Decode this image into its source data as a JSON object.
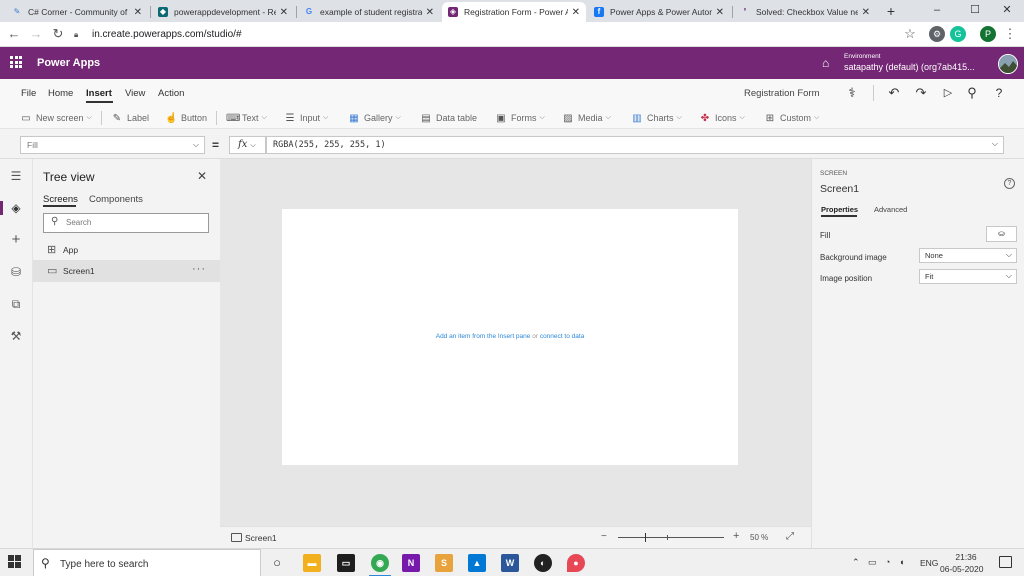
{
  "browser": {
    "tabs": [
      {
        "title": "C# Corner - Community of Software and Data Developers",
        "favicon": "csharp-icon",
        "color": "#3a7bd5"
      },
      {
        "title": "powerappdevelopment - Registration",
        "favicon": "dynamics-icon",
        "color": "#0b6a74"
      },
      {
        "title": "example of student registration form",
        "favicon": "google-icon",
        "color": "#4285f4"
      },
      {
        "title": "Registration Form - Power Apps",
        "favicon": "powerapps-icon",
        "color": "#742774"
      },
      {
        "title": "Power Apps & Power Automate",
        "favicon": "facebook-icon",
        "color": "#1877f2"
      },
      {
        "title": "Solved: Checkbox Value needed",
        "favicon": "powerapps-community-icon",
        "color": "#742774"
      }
    ],
    "new_tab_label": "+",
    "url": "in.create.powerapps.com/studio/#",
    "profile_initial": "P",
    "window_controls": {
      "minimize": "–",
      "maximize": "☐",
      "close": "✕"
    }
  },
  "powerapps": {
    "brand": "Power Apps",
    "environment_label": "Environment",
    "environment_name": "satapathy (default) (org7ab415...",
    "accent_color": "#742774"
  },
  "menu": {
    "items": [
      "File",
      "Home",
      "Insert",
      "View",
      "Action"
    ],
    "active": "Insert",
    "app_name": "Registration Form"
  },
  "toolbar": {
    "items": [
      {
        "label": "New screen",
        "icon": "new-screen-icon",
        "dropdown": true
      },
      {
        "label": "Label",
        "icon": "label-icon",
        "dropdown": false
      },
      {
        "label": "Button",
        "icon": "button-icon",
        "dropdown": false
      },
      {
        "label": "Text",
        "icon": "text-icon",
        "dropdown": true
      },
      {
        "label": "Input",
        "icon": "input-icon",
        "dropdown": true
      },
      {
        "label": "Gallery",
        "icon": "gallery-icon",
        "dropdown": true
      },
      {
        "label": "Data table",
        "icon": "data-table-icon",
        "dropdown": false
      },
      {
        "label": "Forms",
        "icon": "forms-icon",
        "dropdown": true
      },
      {
        "label": "Media",
        "icon": "media-icon",
        "dropdown": true
      },
      {
        "label": "Charts",
        "icon": "charts-icon",
        "dropdown": true
      },
      {
        "label": "Icons",
        "icon": "icons-icon",
        "dropdown": true
      },
      {
        "label": "Custom",
        "icon": "custom-icon",
        "dropdown": true
      }
    ]
  },
  "formula": {
    "property": "Fill",
    "equals": "=",
    "fx_label": "fx",
    "value": "RGBA(255, 255, 255, 1)"
  },
  "treeview": {
    "title": "Tree view",
    "tabs": [
      "Screens",
      "Components"
    ],
    "active_tab": "Screens",
    "search_placeholder": "Search",
    "items": [
      {
        "label": "App",
        "icon": "app-icon",
        "selected": false
      },
      {
        "label": "Screen1",
        "icon": "screen-icon",
        "selected": true,
        "more": "···"
      }
    ]
  },
  "canvas": {
    "message_link1": "Add an item from the Insert pane",
    "message_mid": " or ",
    "message_link2": "connect to data"
  },
  "statusbar": {
    "screen": "Screen1",
    "zoom_minus": "−",
    "zoom_plus": "+",
    "zoom_percent": 50,
    "zoom_label": "50 %"
  },
  "properties": {
    "kind": "SCREEN",
    "name": "Screen1",
    "tabs": [
      "Properties",
      "Advanced"
    ],
    "active_tab": "Properties",
    "rows": [
      {
        "label": "Fill"
      },
      {
        "label": "Background image",
        "value": "None"
      },
      {
        "label": "Image position",
        "value": "Fit"
      }
    ]
  },
  "taskbar": {
    "search_placeholder": "Type here to search",
    "apps": [
      {
        "name": "cortana-icon",
        "color": "#333333"
      },
      {
        "name": "file-explorer-icon",
        "color": "#f2b01e"
      },
      {
        "name": "cmd-icon",
        "color": "#1e1e1e"
      },
      {
        "name": "chrome-icon",
        "color": "#34a853"
      },
      {
        "name": "onenote-icon",
        "color": "#7719aa"
      },
      {
        "name": "sublime-icon",
        "color": "#e8a33d"
      },
      {
        "name": "photos-icon",
        "color": "#0078d4"
      },
      {
        "name": "word-icon",
        "color": "#2b579a"
      },
      {
        "name": "xbox-icon",
        "color": "#222222"
      },
      {
        "name": "paint-icon",
        "color": "#e74856"
      }
    ],
    "language": "ENG",
    "time": "21:36",
    "date": "06-05-2020"
  }
}
